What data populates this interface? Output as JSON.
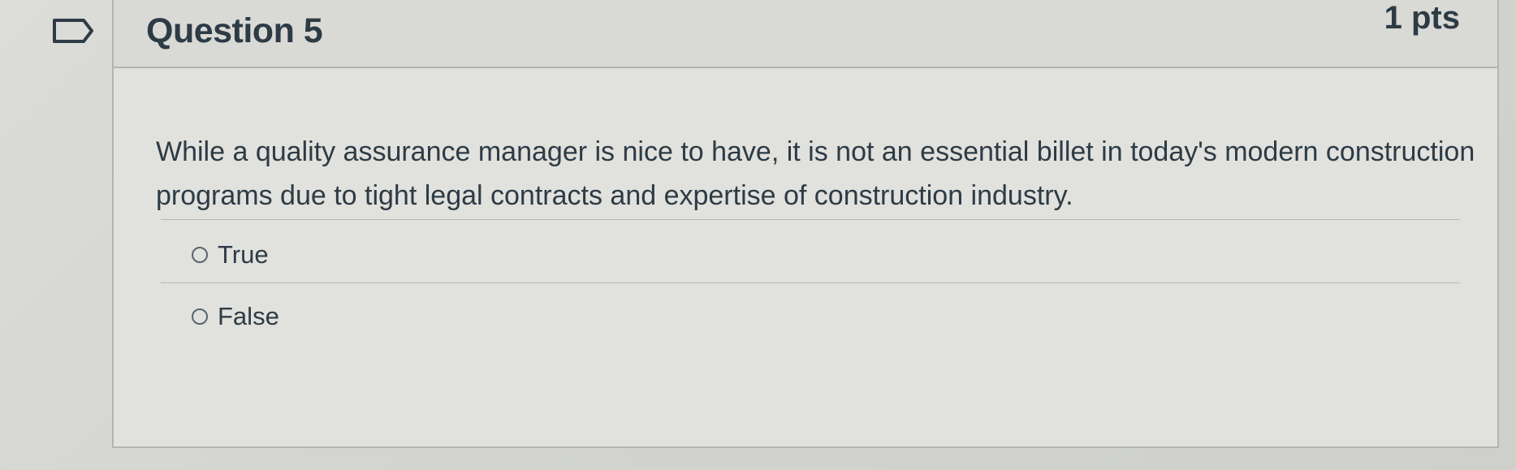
{
  "question": {
    "title": "Question 5",
    "points": "1 pts",
    "flag_icon": "bookmark-flag-icon",
    "text": "While a  quality assurance manager is nice to have, it is not an essential billet in today's modern construction programs due to tight legal contracts and expertise of construction industry.",
    "answers": [
      {
        "label": "True",
        "selected": false
      },
      {
        "label": "False",
        "selected": false
      }
    ]
  },
  "colors": {
    "text": "#2d3b45",
    "border": "#b4b5b1",
    "background": "#d7d7d3"
  }
}
